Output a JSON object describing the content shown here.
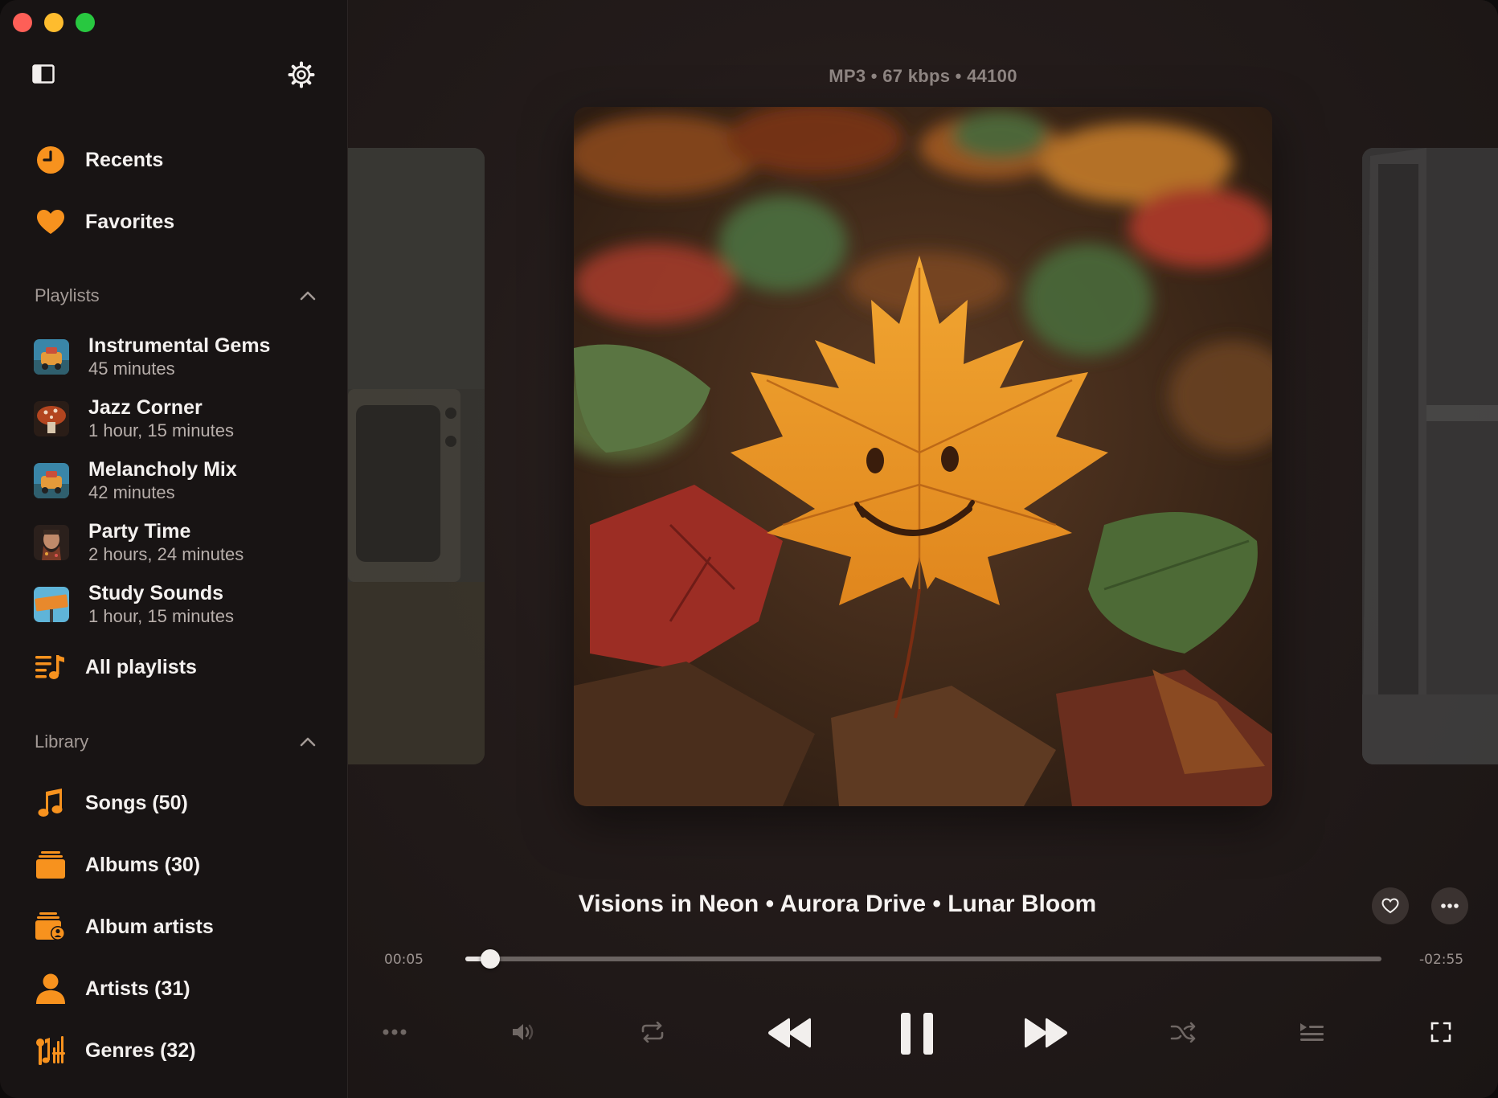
{
  "window": {
    "controls": [
      "close",
      "minimize",
      "zoom"
    ]
  },
  "sidebar": {
    "top_icons": [
      "sidebar-toggle-icon",
      "gear-icon"
    ],
    "nav": [
      {
        "label": "Recents",
        "icon": "clock-icon"
      },
      {
        "label": "Favorites",
        "icon": "heart-icon"
      }
    ],
    "playlists_header": "Playlists",
    "playlists": [
      {
        "name": "Instrumental Gems",
        "duration": "45 minutes"
      },
      {
        "name": "Jazz Corner",
        "duration": "1 hour, 15 minutes"
      },
      {
        "name": "Melancholy Mix",
        "duration": "42 minutes"
      },
      {
        "name": "Party Time",
        "duration": "2 hours, 24 minutes"
      },
      {
        "name": "Study Sounds",
        "duration": "1 hour, 15 minutes"
      }
    ],
    "all_playlists": "All playlists",
    "library_header": "Library",
    "library": [
      {
        "label": "Songs (50)",
        "icon": "music-note-icon"
      },
      {
        "label": "Albums (30)",
        "icon": "albums-icon"
      },
      {
        "label": "Album artists",
        "icon": "album-artist-icon"
      },
      {
        "label": "Artists (31)",
        "icon": "person-icon"
      },
      {
        "label": "Genres (32)",
        "icon": "genres-icon"
      }
    ]
  },
  "player": {
    "format": "MP3 • 67 kbps • 44100",
    "title": "Visions in Neon • Aurora Drive • Lunar Bloom",
    "elapsed": "00:05",
    "remaining": "-02:55",
    "progress": 0.027,
    "accent": "#f7921e"
  }
}
